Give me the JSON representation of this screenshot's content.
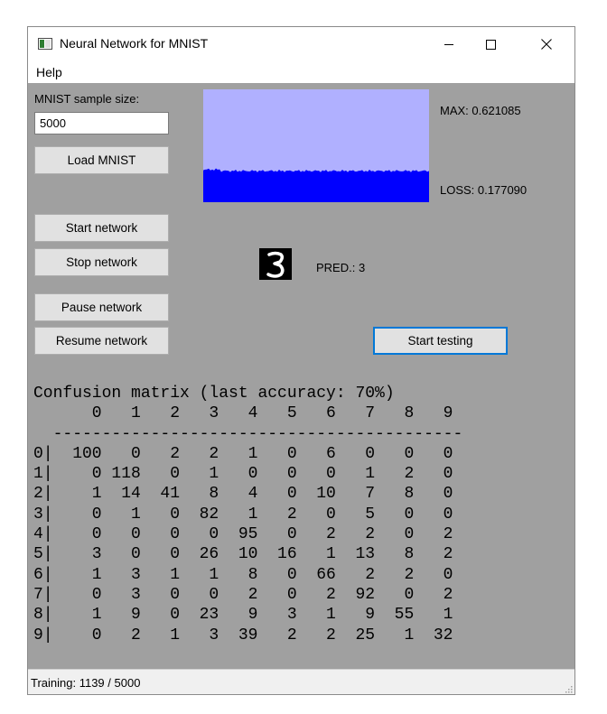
{
  "window": {
    "title": "Neural Network for MNIST",
    "accent": "#0078d7",
    "background": "#a0a0a0"
  },
  "menu": {
    "items": [
      "Help"
    ]
  },
  "sample": {
    "label": "MNIST sample size:",
    "value": "5000"
  },
  "buttons": {
    "load": "Load MNIST",
    "start": "Start network",
    "stop": "Stop network",
    "pause": "Pause network",
    "resume": "Resume network",
    "testing": "Start testing"
  },
  "graph": {
    "max_label": "MAX: 0.621085",
    "loss_label": "LOSS: 0.177090",
    "max": 0.621085,
    "loss": 0.17709,
    "fill_color": "#0000ff",
    "bg_color": "#b0b0ff"
  },
  "prediction": {
    "label": "PRED.: 3",
    "digit": "3"
  },
  "matrix": {
    "title": "Confusion matrix (last accuracy: 70%)",
    "columns": [
      0,
      1,
      2,
      3,
      4,
      5,
      6,
      7,
      8,
      9
    ],
    "rows": [
      [
        100,
        0,
        2,
        2,
        1,
        0,
        6,
        0,
        0,
        0
      ],
      [
        0,
        118,
        0,
        1,
        0,
        0,
        0,
        1,
        2,
        0
      ],
      [
        1,
        14,
        41,
        8,
        4,
        0,
        10,
        7,
        8,
        0
      ],
      [
        0,
        1,
        0,
        82,
        1,
        2,
        0,
        5,
        0,
        0
      ],
      [
        0,
        0,
        0,
        0,
        95,
        0,
        2,
        2,
        0,
        2
      ],
      [
        3,
        0,
        0,
        26,
        10,
        16,
        1,
        13,
        8,
        2
      ],
      [
        1,
        3,
        1,
        1,
        8,
        0,
        66,
        2,
        2,
        0
      ],
      [
        0,
        3,
        0,
        0,
        2,
        0,
        2,
        92,
        0,
        2
      ],
      [
        1,
        9,
        0,
        23,
        9,
        3,
        1,
        9,
        55,
        1
      ],
      [
        0,
        2,
        1,
        3,
        39,
        2,
        2,
        25,
        1,
        32
      ]
    ]
  },
  "status": {
    "text": "Training: 1139 / 5000"
  }
}
